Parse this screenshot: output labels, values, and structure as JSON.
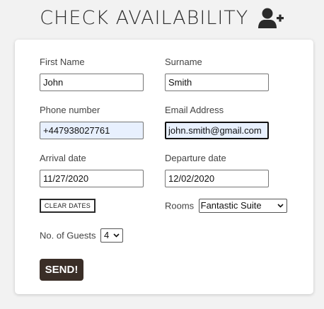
{
  "header": {
    "title": "CHECK AVAILABILITY",
    "icon": "user-plus-icon"
  },
  "form": {
    "first_name": {
      "label": "First Name",
      "value": "John"
    },
    "surname": {
      "label": "Surname",
      "value": "Smith"
    },
    "phone": {
      "label": "Phone number",
      "value": "+447938027761"
    },
    "email": {
      "label": "Email Address",
      "value": "john.smith@gmail.com"
    },
    "arrival": {
      "label": "Arrival date",
      "value": "11/27/2020"
    },
    "departure": {
      "label": "Departure date",
      "value": "12/02/2020"
    },
    "clear_dates_label": "CLEAR DATES",
    "rooms": {
      "label": "Rooms",
      "selected": "Fantastic Suite"
    },
    "guests": {
      "label": "No. of Guests",
      "selected": "4"
    },
    "send_label": "SEND!"
  },
  "colors": {
    "page_background": "#f2f2f2",
    "card_background": "#ffffff",
    "send_button": "#3a2e27",
    "autofill_background": "#e8f0fe"
  }
}
